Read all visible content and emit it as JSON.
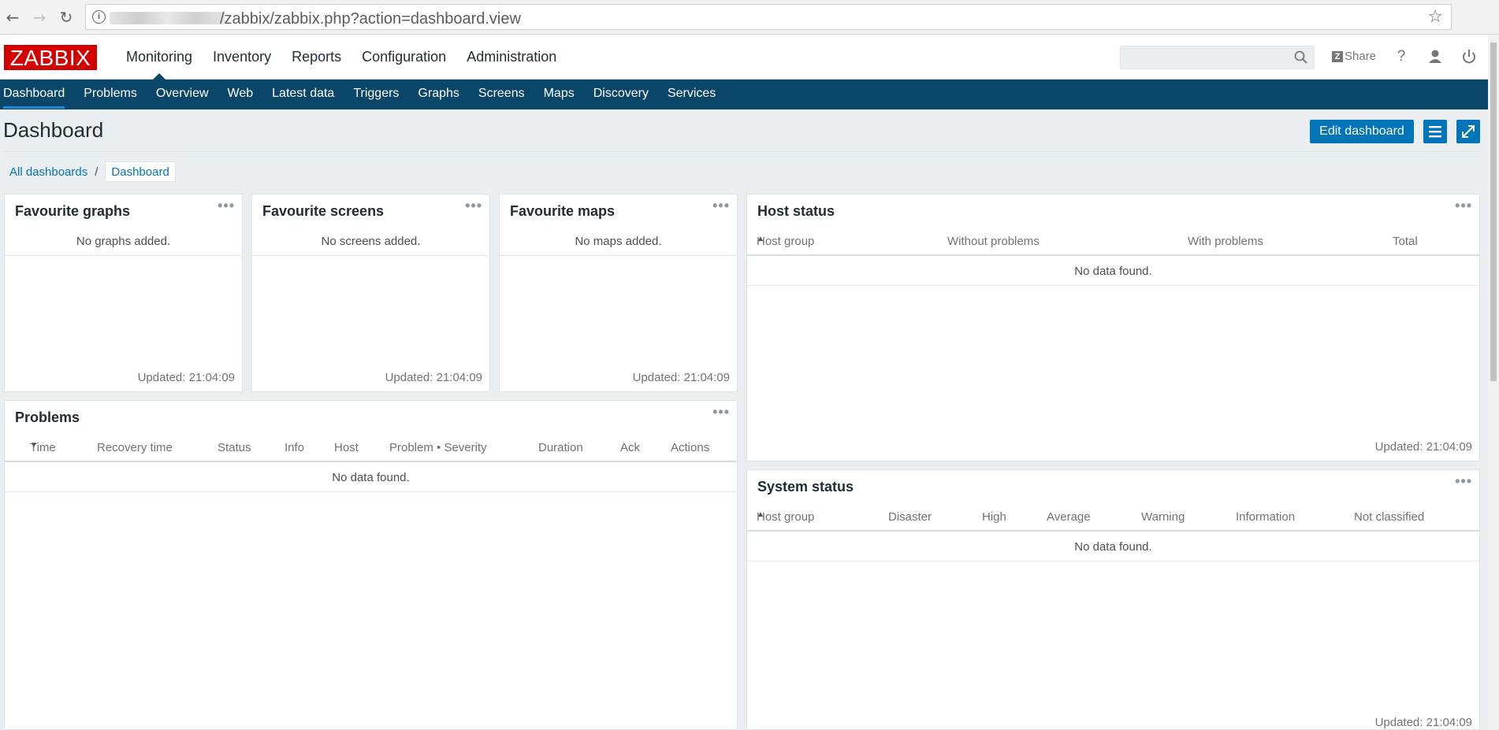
{
  "browser": {
    "url_text": "/zabbix/zabbix.php?action=dashboard.view"
  },
  "header": {
    "logo": "ZABBIX",
    "menu": [
      "Monitoring",
      "Inventory",
      "Reports",
      "Configuration",
      "Administration"
    ],
    "active_menu": "Monitoring",
    "share_label": "Share",
    "help_label": "?"
  },
  "submenu": [
    "Dashboard",
    "Problems",
    "Overview",
    "Web",
    "Latest data",
    "Triggers",
    "Graphs",
    "Screens",
    "Maps",
    "Discovery",
    "Services"
  ],
  "page": {
    "title": "Dashboard",
    "edit_button": "Edit dashboard",
    "breadcrumb": [
      "All dashboards",
      "Dashboard"
    ],
    "breadcrumb_sep": "/"
  },
  "widgets": {
    "fav_graphs": {
      "title": "Favourite graphs",
      "message": "No graphs added.",
      "updated": "Updated: 21:04:09"
    },
    "fav_screens": {
      "title": "Favourite screens",
      "message": "No screens added.",
      "updated": "Updated: 21:04:09"
    },
    "fav_maps": {
      "title": "Favourite maps",
      "message": "No maps added.",
      "updated": "Updated: 21:04:09"
    },
    "host_status": {
      "title": "Host status",
      "columns": [
        "Host group",
        "Without problems",
        "With problems",
        "Total"
      ],
      "message": "No data found.",
      "updated": "Updated: 21:04:09"
    },
    "problems": {
      "title": "Problems",
      "columns": [
        "Time",
        "Recovery time",
        "Status",
        "Info",
        "Host",
        "Problem • Severity",
        "Duration",
        "Ack",
        "Actions"
      ],
      "message": "No data found."
    },
    "system_status": {
      "title": "System status",
      "columns": [
        "Host group",
        "Disaster",
        "High",
        "Average",
        "Warning",
        "Information",
        "Not classified"
      ],
      "message": "No data found.",
      "updated": "Updated: 21:04:09"
    }
  },
  "widget_menu_glyph": "•••",
  "colors": {
    "logo_red": "#d40000",
    "submenu_bg": "#0a466a",
    "button_blue": "#0275b8",
    "page_bg": "#ebeef0"
  }
}
